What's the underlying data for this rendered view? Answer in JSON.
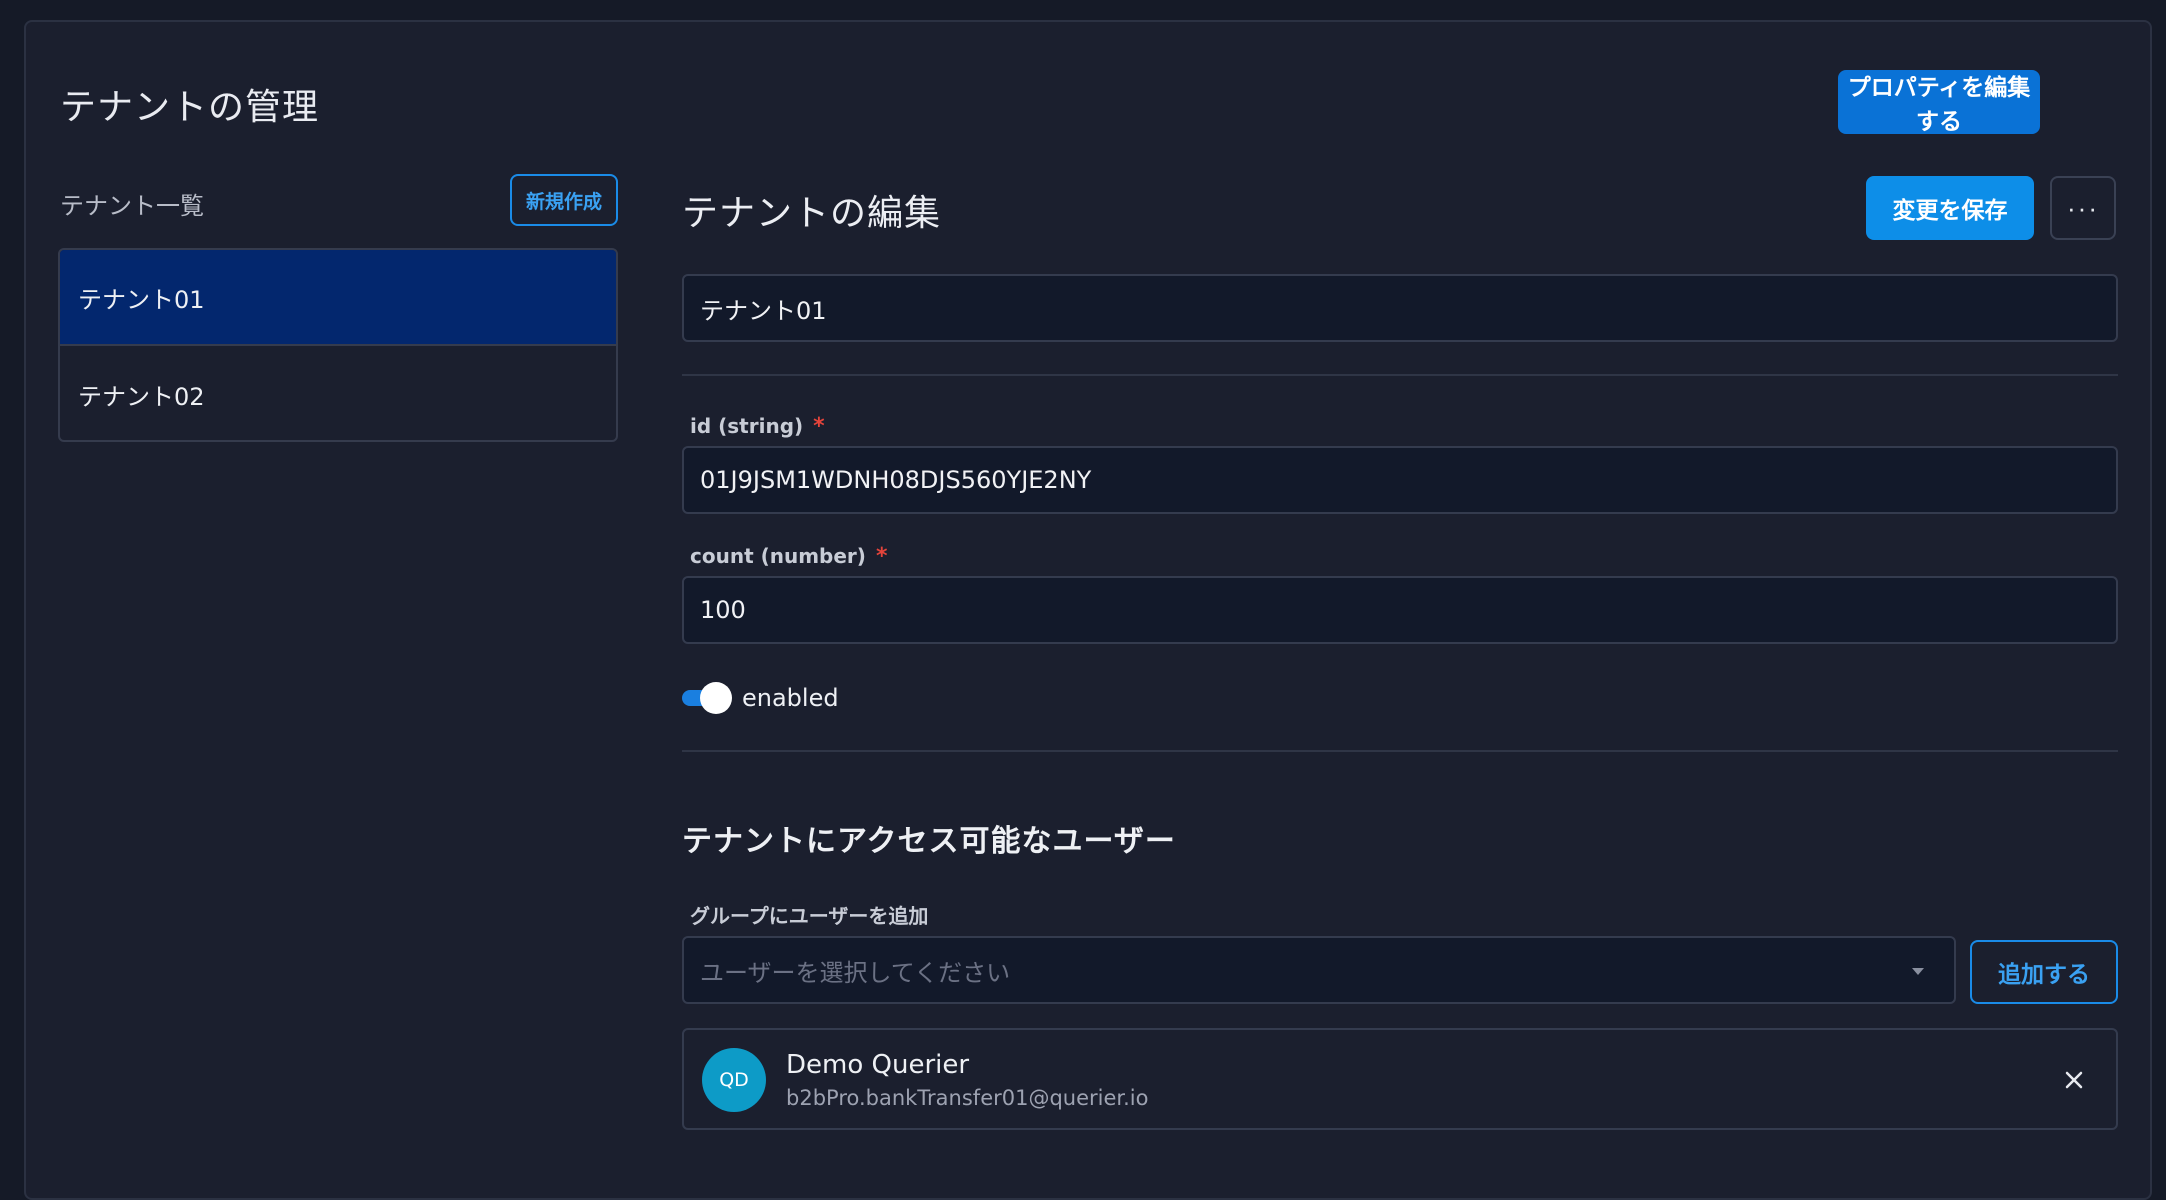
{
  "header": {
    "title": "テナントの管理",
    "edit_properties_label": "プロパティを編集する"
  },
  "sidebar": {
    "label": "テナント一覧",
    "new_label": "新規作成",
    "items": [
      {
        "label": "テナント01",
        "selected": true
      },
      {
        "label": "テナント02",
        "selected": false
      }
    ]
  },
  "editor": {
    "title": "テナントの編集",
    "save_label": "変更を保存",
    "more_label": "···",
    "name_value": "テナント01",
    "fields": {
      "id": {
        "label": "id (string)",
        "required": "*",
        "value": "01J9JSM1WDNH08DJS560YJE2NY"
      },
      "count": {
        "label": "count (number)",
        "required": "*",
        "value": "100"
      }
    },
    "enabled": {
      "label": "enabled",
      "on": true
    }
  },
  "users": {
    "title": "テナントにアクセス可能なユーザー",
    "add_label": "グループにユーザーを追加",
    "select_placeholder": "ユーザーを選択してください",
    "add_button": "追加する",
    "list": [
      {
        "initials": "QD",
        "name": "Demo Querier",
        "email": "b2bPro.bankTransfer01@querier.io"
      }
    ]
  },
  "colors": {
    "accent": "#0a72d6",
    "selected_row": "#03276e",
    "required": "#e5443b",
    "avatar": "#0d9bc7"
  }
}
